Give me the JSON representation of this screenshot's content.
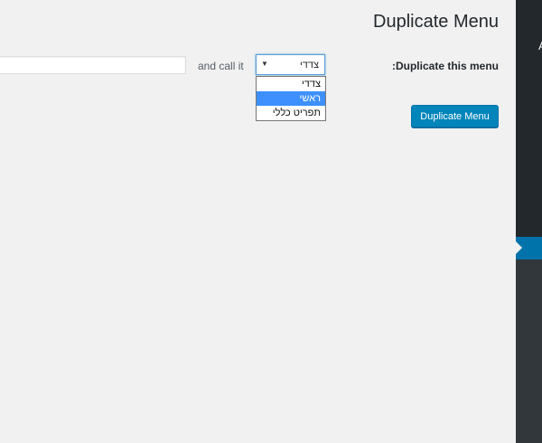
{
  "page": {
    "title": "Duplicate Menu"
  },
  "form": {
    "row_label": ":Duplicate this menu",
    "select": {
      "value": "צדדי",
      "arrow_icon": "triangle-down-icon",
      "options": [
        "צדדי",
        "ראשי",
        "תפריט כללי"
      ],
      "highlighted_option": "ראשי"
    },
    "call_label": "and call it",
    "name_input": {
      "value": "",
      "placeholder": ""
    },
    "submit_label": "Duplicate Menu"
  },
  "sidebar": {
    "partial_item_text": "A"
  },
  "colors": {
    "primary": "#0085ba",
    "sidebar": "#23282d",
    "sidebar_submenu": "#32373c",
    "sidebar_active": "#0073aa",
    "option_highlight": "#3e90ff"
  }
}
